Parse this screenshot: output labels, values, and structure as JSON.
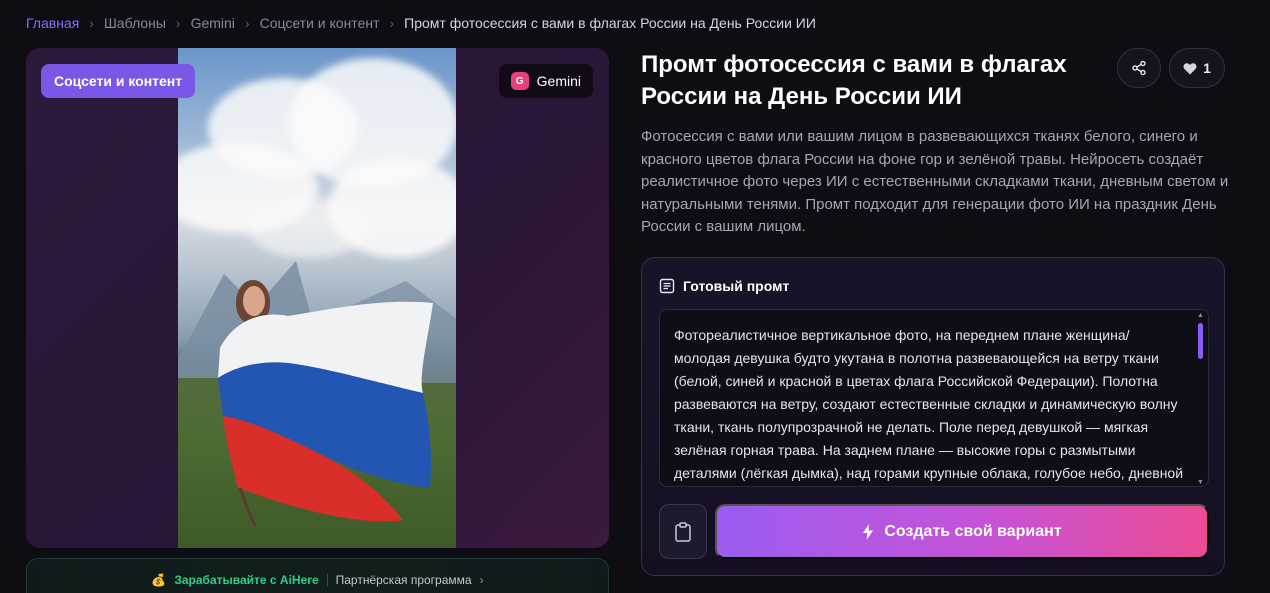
{
  "breadcrumb": {
    "items": [
      "Главная",
      "Шаблоны",
      "Gemini",
      "Соцсети и контент"
    ],
    "current": "Промт фотосессия с вами в флагах России на День России ИИ"
  },
  "image_card": {
    "category_tag": "Соцсети и контент",
    "model_tag": {
      "icon_letter": "G",
      "label": "Gemini",
      "icon_color": "#e8407c"
    }
  },
  "affiliate": {
    "icon": "money-bag-icon",
    "label": "Зарабатывайте с AiHere",
    "sub": "Партнёрская программа"
  },
  "header": {
    "title": "Промт фотосессия с вами в флагах России на День России ИИ",
    "share_icon": "share-icon",
    "like_icon": "heart-icon",
    "like_count": "1"
  },
  "description": "Фотосессия с вами или вашим лицом в развевающихся тканях белого, синего и красного цветов флага России на фоне гор и зелёной травы. Нейросеть создаёт реалистичное фото через ИИ с естественными складками ткани, дневным светом и натуральными тенями. Промт подходит для генерации фото ИИ на праздник День России с вашим лицом.",
  "prompt": {
    "header": "Готовый промт",
    "text": "Фотореалистичное вертикальное фото, на переднем плане женщина/молодая девушка будто укутана в полотна развевающейся на ветру ткани (белой, синей и красной в цветах флага Российской Федерации). Полотна развеваются на ветру, создают естественные складки и динамическую волну ткани, ткань полупрозрачной не делать. Поле перед девушкой — мягкая зелёная горная трава. На заднем плане — высокие горы с размытыми деталями (лёгкая дымка), над горами крупные облака, голубое небо, дневной свет, реалистичная",
    "copy_icon": "clipboard-icon",
    "create_label": "Создать свой вариант",
    "create_icon": "lightning-icon"
  },
  "colors": {
    "accent": "#8b6cf6",
    "category_tag": "#7b57e8",
    "affiliate_green": "#2fcf8a",
    "gradient_start": "#9b5cf0",
    "gradient_end": "#ec4b94"
  }
}
